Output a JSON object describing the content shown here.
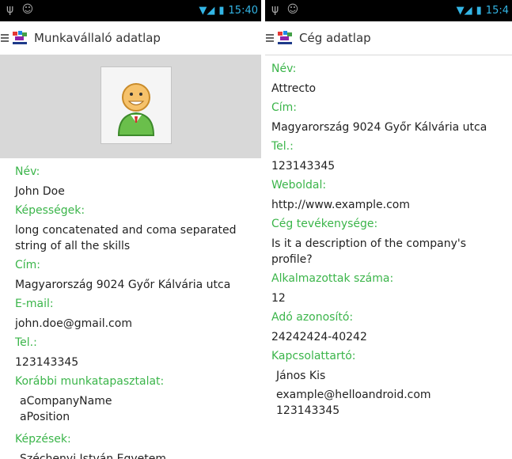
{
  "status": {
    "time_left": "15:40",
    "time_right": "15:4"
  },
  "employee": {
    "title": "Munkavállaló adatlap",
    "name_label": "Név:",
    "name": "John Doe",
    "skills_label": "Képességek:",
    "skills_1": "long concatenated and coma separated",
    "skills_2": "string of all the skills",
    "address_label": "Cím:",
    "address": "Magyarország 9024 Győr Kálvária utca",
    "email_label": "E-mail:",
    "email": "john.doe@gmail.com",
    "phone_label": "Tel.:",
    "phone": "123143345",
    "experience_label": "Korábbi munkatapasztalat:",
    "company": "aCompanyName",
    "position": "aPosition",
    "training_label": "Képzések:",
    "training_partial": "Széchenyi István Egyetem"
  },
  "company": {
    "title": "Cég adatlap",
    "name_label": "Név:",
    "name": "Attrecto",
    "address_label": "Cím:",
    "address": "Magyarország 9024 Győr Kálvária utca",
    "phone_label": "Tel.:",
    "phone": "123143345",
    "website_label": "Weboldal:",
    "website": "http://www.example.com",
    "activity_label": "Cég tevékenysége:",
    "activity_1": "Is it a description of the company's",
    "activity_2": "profile?",
    "employees_label": "Alkalmazottak száma:",
    "employees": "12",
    "tax_label": "Adó azonosító:",
    "tax_id": "24242424-40242",
    "contact_label": "Kapcsolattartó:",
    "contact_name": "János Kis",
    "contact_email": "example@helloandroid.com",
    "contact_phone": "123143345"
  }
}
